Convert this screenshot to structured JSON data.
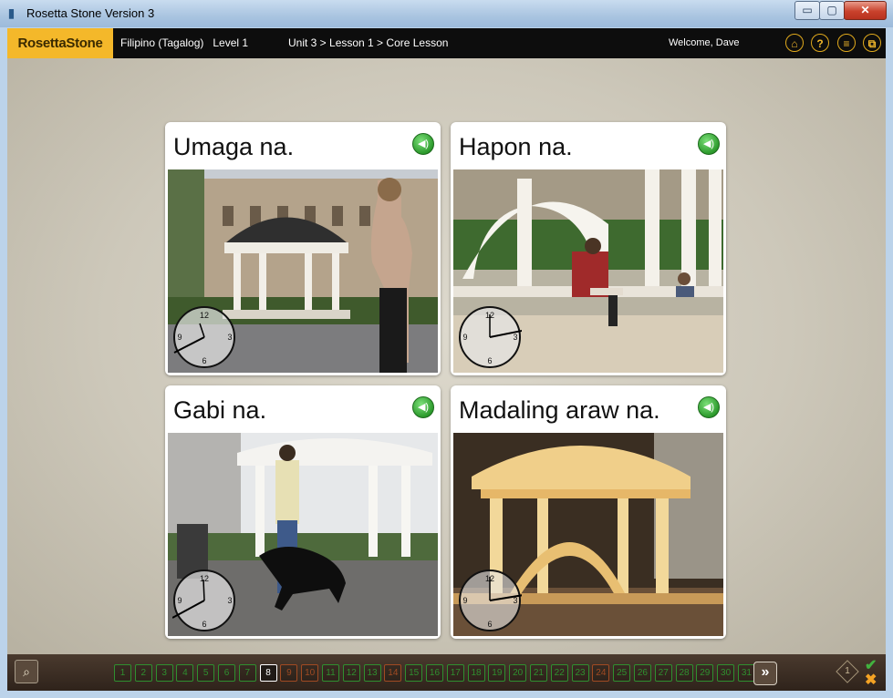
{
  "window": {
    "title": "Rosetta Stone Version 3",
    "icon": "app-icon",
    "controls": {
      "minimize": "▭",
      "maximize": "▢",
      "close": "✕"
    }
  },
  "header": {
    "logo": "RosettaStone",
    "course": "Filipino (Tagalog)   Level 1",
    "breadcrumb": "Unit 3 > Lesson 1 > Core Lesson",
    "welcome": "Welcome, Dave",
    "buttons": [
      {
        "name": "home-icon",
        "glyph": "⌂"
      },
      {
        "name": "help-icon",
        "glyph": "?"
      },
      {
        "name": "menu-icon",
        "glyph": "≡"
      },
      {
        "name": "window-mode-icon",
        "glyph": "⧉"
      }
    ]
  },
  "cards": [
    {
      "title": "Umaga na.",
      "scene": "daytime gazebo with woman walking",
      "clock_numbers": [
        "12",
        "3",
        "6",
        "9"
      ]
    },
    {
      "title": "Hapon na.",
      "scene": "afternoon gazebo with woman reading",
      "clock_numbers": [
        "12",
        "3",
        "6",
        "9"
      ]
    },
    {
      "title": "Gabi na.",
      "scene": "evening gazebo with woman walking dog",
      "clock_numbers": [
        "12",
        "3",
        "6",
        "9"
      ]
    },
    {
      "title": "Madaling araw na.",
      "scene": "dawn gazebo lit at night",
      "clock_numbers": [
        "12",
        "3",
        "6",
        "9"
      ]
    }
  ],
  "footer": {
    "zoom_icon": "zoom-icon",
    "pages": [
      "1",
      "2",
      "3",
      "4",
      "5",
      "6",
      "7",
      "8",
      "9",
      "10",
      "11",
      "12",
      "13",
      "14",
      "15",
      "16",
      "17",
      "18",
      "19",
      "20",
      "21",
      "22",
      "23",
      "24",
      "25",
      "26",
      "27",
      "28",
      "29",
      "30",
      "31"
    ],
    "current_page": "8",
    "next_label": "»",
    "diamond_label": "1",
    "colors": {
      "done": "#2f8f2f",
      "current": "#ffffff",
      "alt": "#a04a22"
    }
  }
}
